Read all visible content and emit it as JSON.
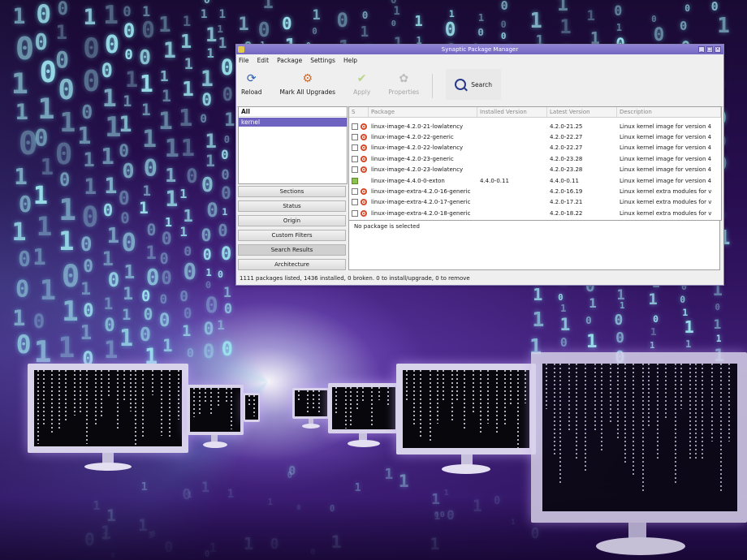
{
  "window": {
    "title": "Synaptic Package Manager",
    "accent_color": "#7366c4",
    "controls": [
      "minimize-icon",
      "maximize-icon",
      "close-icon"
    ]
  },
  "menu": [
    "File",
    "Edit",
    "Package",
    "Settings",
    "Help"
  ],
  "toolbar": {
    "reload": "Reload",
    "mark_all": "Mark All Upgrades",
    "apply": "Apply",
    "properties": "Properties",
    "search": "Search"
  },
  "filters": {
    "header": "All",
    "selected": "kernel",
    "buttons": [
      "Sections",
      "Status",
      "Origin",
      "Custom Filters",
      "Search Results",
      "Architecture"
    ],
    "active_button": "Search Results"
  },
  "table": {
    "columns": [
      "S",
      "Package",
      "Installed Version",
      "Latest Version",
      "Description"
    ],
    "rows": [
      {
        "status": "not-installed",
        "package": "linux-image-4.2.0-21-lowlatency",
        "installed": "",
        "latest": "4.2.0-21.25",
        "description": "Linux kernel image for version 4"
      },
      {
        "status": "not-installed",
        "package": "linux-image-4.2.0-22-generic",
        "installed": "",
        "latest": "4.2.0-22.27",
        "description": "Linux kernel image for version 4"
      },
      {
        "status": "not-installed",
        "package": "linux-image-4.2.0-22-lowlatency",
        "installed": "",
        "latest": "4.2.0-22.27",
        "description": "Linux kernel image for version 4"
      },
      {
        "status": "not-installed",
        "package": "linux-image-4.2.0-23-generic",
        "installed": "",
        "latest": "4.2.0-23.28",
        "description": "Linux kernel image for version 4"
      },
      {
        "status": "not-installed",
        "package": "linux-image-4.2.0-23-lowlatency",
        "installed": "",
        "latest": "4.2.0-23.28",
        "description": "Linux kernel image for version 4"
      },
      {
        "status": "installed",
        "package": "linux-image-4.4.0-0-exton",
        "installed": "4.4.0-0.11",
        "latest": "4.4.0-0.11",
        "description": "Linux kernel image for version 4"
      },
      {
        "status": "not-installed",
        "package": "linux-image-extra-4.2.0-16-generic",
        "installed": "",
        "latest": "4.2.0-16.19",
        "description": "Linux kernel extra modules for v"
      },
      {
        "status": "not-installed",
        "package": "linux-image-extra-4.2.0-17-generic",
        "installed": "",
        "latest": "4.2.0-17.21",
        "description": "Linux kernel extra modules for v"
      },
      {
        "status": "not-installed",
        "package": "linux-image-extra-4.2.0-18-generic",
        "installed": "",
        "latest": "4.2.0-18.22",
        "description": "Linux kernel extra modules for v"
      }
    ]
  },
  "details": {
    "text": "No package is selected"
  },
  "status_bar": {
    "text": "1111 packages listed, 1436 installed, 0 broken. 0 to install/upgrade, 0 to remove"
  }
}
